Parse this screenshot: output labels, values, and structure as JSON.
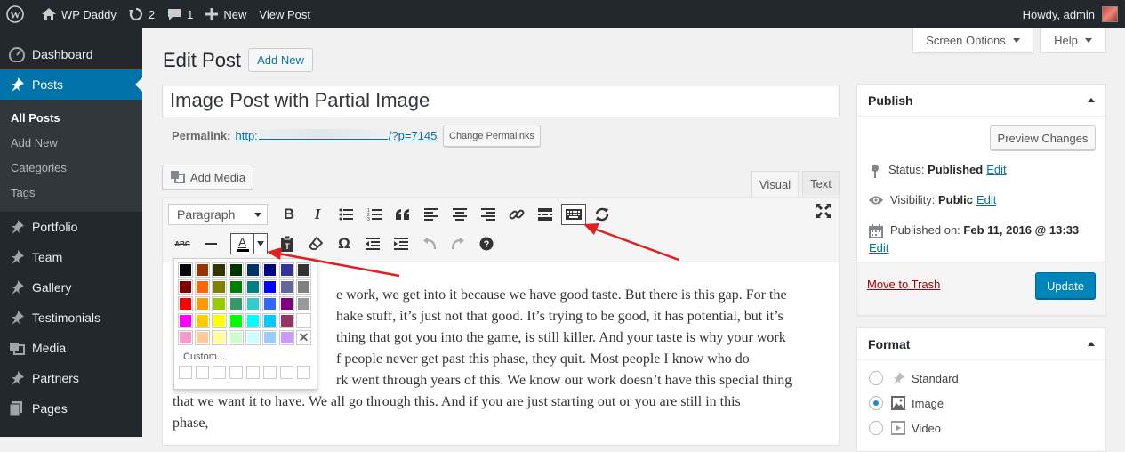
{
  "adminbar": {
    "site_name": "WP Daddy",
    "updates_count": "2",
    "comments_count": "1",
    "new_label": "New",
    "view_post_label": "View Post",
    "howdy": "Howdy, admin"
  },
  "sidebar": {
    "items": [
      {
        "label": "Dashboard",
        "icon": "dashboard-icon"
      },
      {
        "label": "Posts",
        "icon": "pin-icon"
      },
      {
        "label": "Portfolio",
        "icon": "pin-icon"
      },
      {
        "label": "Team",
        "icon": "pin-icon"
      },
      {
        "label": "Gallery",
        "icon": "pin-icon"
      },
      {
        "label": "Testimonials",
        "icon": "pin-icon"
      },
      {
        "label": "Media",
        "icon": "media-icon"
      },
      {
        "label": "Partners",
        "icon": "pin-icon"
      },
      {
        "label": "Pages",
        "icon": "pages-icon"
      }
    ],
    "submenu": [
      "All Posts",
      "Add New",
      "Categories",
      "Tags"
    ]
  },
  "header": {
    "screen_options": "Screen Options",
    "help": "Help",
    "title": "Edit Post",
    "add_new": "Add New"
  },
  "post": {
    "title": "Image Post with Partial Image",
    "permalink_label": "Permalink:",
    "permalink_prefix": "http:",
    "permalink_suffix": "/?p=7145",
    "change_permalinks": "Change Permalinks"
  },
  "editor": {
    "add_media": "Add Media",
    "tab_visual": "Visual",
    "tab_text": "Text",
    "format_select": "Paragraph",
    "content_lines": [
      "e work, we get into it because we have good taste. But there is this gap. For the",
      "hake stuff, it’s just not that good. It’s trying to be good, it has potential, but it’s",
      "thing that got you into the game, is still killer. And your taste is why your work",
      "f people never get past this phase, they quit. Most people I know who do",
      "rk went through years of this. We know our work doesn’t have this special thing",
      "that we want it to have. We all go through this. And if you are just starting out or you are still in this",
      "phase,"
    ]
  },
  "colorpicker": {
    "custom_label": "Custom...",
    "swatches": [
      "#000000",
      "#993300",
      "#333300",
      "#003300",
      "#003366",
      "#000080",
      "#333399",
      "#333333",
      "#800000",
      "#ff6600",
      "#808000",
      "#008000",
      "#008080",
      "#0000ff",
      "#666699",
      "#808080",
      "#ff0000",
      "#ff9900",
      "#99cc00",
      "#339966",
      "#33cccc",
      "#3366ff",
      "#800080",
      "#999999",
      "#ff00ff",
      "#ffcc00",
      "#ffff00",
      "#00ff00",
      "#00ffff",
      "#00ccff",
      "#993366",
      "#ffffff",
      "#ff99cc",
      "#ffcc99",
      "#ffff99",
      "#ccffcc",
      "#ccffff",
      "#99ccff",
      "#cc99ff",
      "none"
    ]
  },
  "publish": {
    "title": "Publish",
    "preview_changes": "Preview Changes",
    "status_label": "Status:",
    "status_value": "Published",
    "visibility_label": "Visibility:",
    "visibility_value": "Public",
    "published_label": "Published on:",
    "published_value": "Feb 11, 2016 @ 13:33",
    "edit": "Edit",
    "move_to_trash": "Move to Trash",
    "update": "Update"
  },
  "format": {
    "title": "Format",
    "options": [
      {
        "label": "Standard",
        "checked": false
      },
      {
        "label": "Image",
        "checked": true
      },
      {
        "label": "Video",
        "checked": false
      }
    ]
  },
  "colors": {
    "accent": "#0073aa",
    "adminbar": "#23282d",
    "update_button": "#0085ba",
    "annotation_arrow": "#e02020"
  }
}
